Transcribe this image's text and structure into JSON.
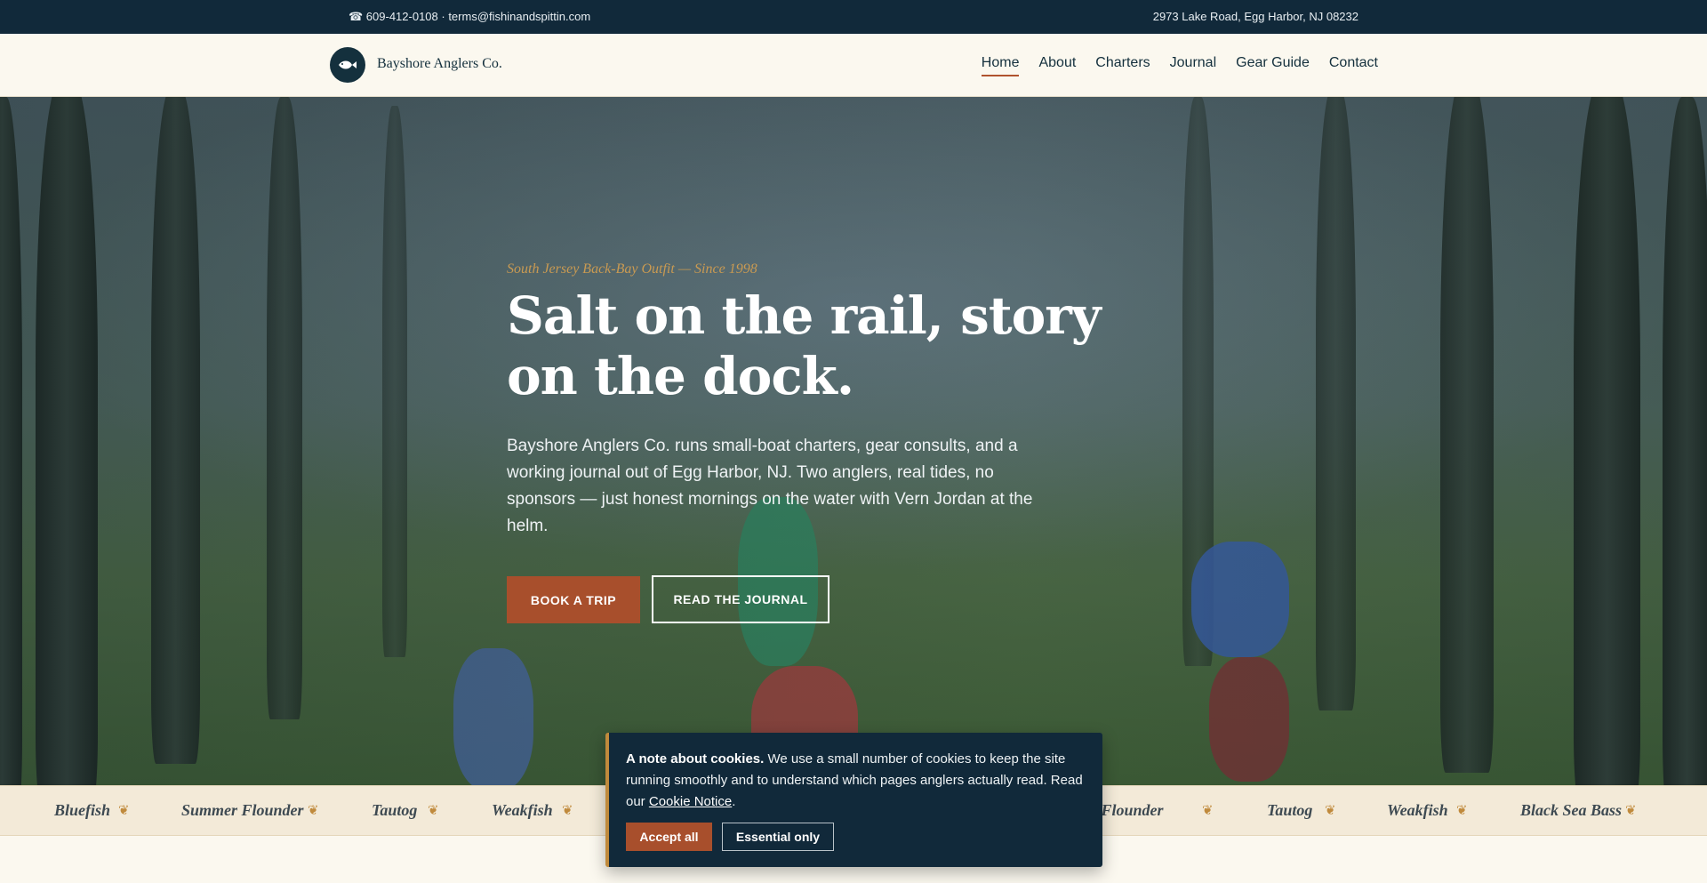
{
  "topbar": {
    "contact": "☎ 609-412-0108 · terms@fishinandspittin.com",
    "address": "2973 Lake Road, Egg Harbor, NJ 08232"
  },
  "brand": {
    "name": "Bayshore Anglers Co."
  },
  "nav": {
    "items": [
      {
        "label": "Home"
      },
      {
        "label": "About"
      },
      {
        "label": "Charters"
      },
      {
        "label": "Journal"
      },
      {
        "label": "Gear Guide"
      },
      {
        "label": "Contact"
      }
    ]
  },
  "hero": {
    "eyebrow": "South Jersey Back-Bay Outfit — Since 1998",
    "headline": "Salt on the rail, story on the dock.",
    "lead": "Bayshore Anglers Co. runs small-boat charters, gear consults, and a working journal out of Egg Harbor, NJ. Two anglers, real tides, no sponsors — just honest mornings on the water with Vern Jordan at the helm.",
    "primary_cta": "BOOK A TRIP",
    "secondary_cta": "READ THE JOURNAL"
  },
  "ticker": {
    "ornament": "❦",
    "items": [
      "Bluefish",
      "Summer Flounder",
      "Tautog",
      "Weakfish",
      "mer Flounder",
      "Tautog",
      "Weakfish",
      "Black Sea Bass"
    ]
  },
  "cookie": {
    "title": "A note about cookies.",
    "body": " We use a small number of cookies to keep the site running smoothly and to understand which pages anglers actually read. Read our ",
    "link": "Cookie Notice",
    "end": ".",
    "accept": "Accept all",
    "essential": "Essential only"
  },
  "colors": {
    "navy": "#11293a",
    "rust": "#a84f2c",
    "gold": "#c08a3c",
    "cream": "#fbf8ef"
  }
}
